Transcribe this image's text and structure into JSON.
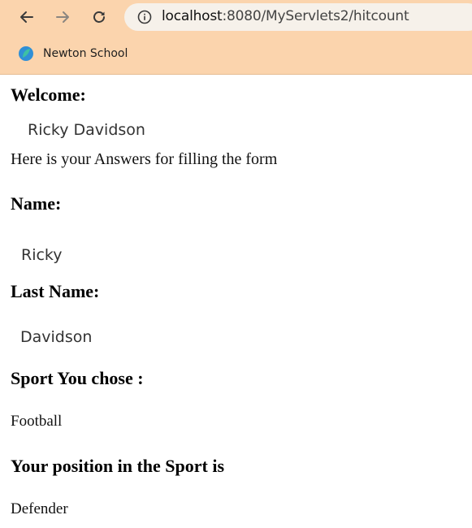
{
  "browser": {
    "url_host": "localhost",
    "url_path": ":8080/MyServlets2/hitcount",
    "bookmarks": [
      {
        "label": "Newton School"
      }
    ],
    "colors": {
      "toolbar": "#fbd4ad",
      "omnibox": "#f6f1ea"
    }
  },
  "page": {
    "welcome_heading": "Welcome:",
    "welcome_name": "Ricky Davidson",
    "intro": "Here is your Answers for filling the form",
    "name_heading": "Name:",
    "name_value": "Ricky",
    "last_name_heading": "Last Name:",
    "last_name_value": "Davidson",
    "sport_heading": "Sport You chose :",
    "sport_value": "Football",
    "position_heading": "Your position in the Sport is",
    "position_value": "Defender"
  }
}
